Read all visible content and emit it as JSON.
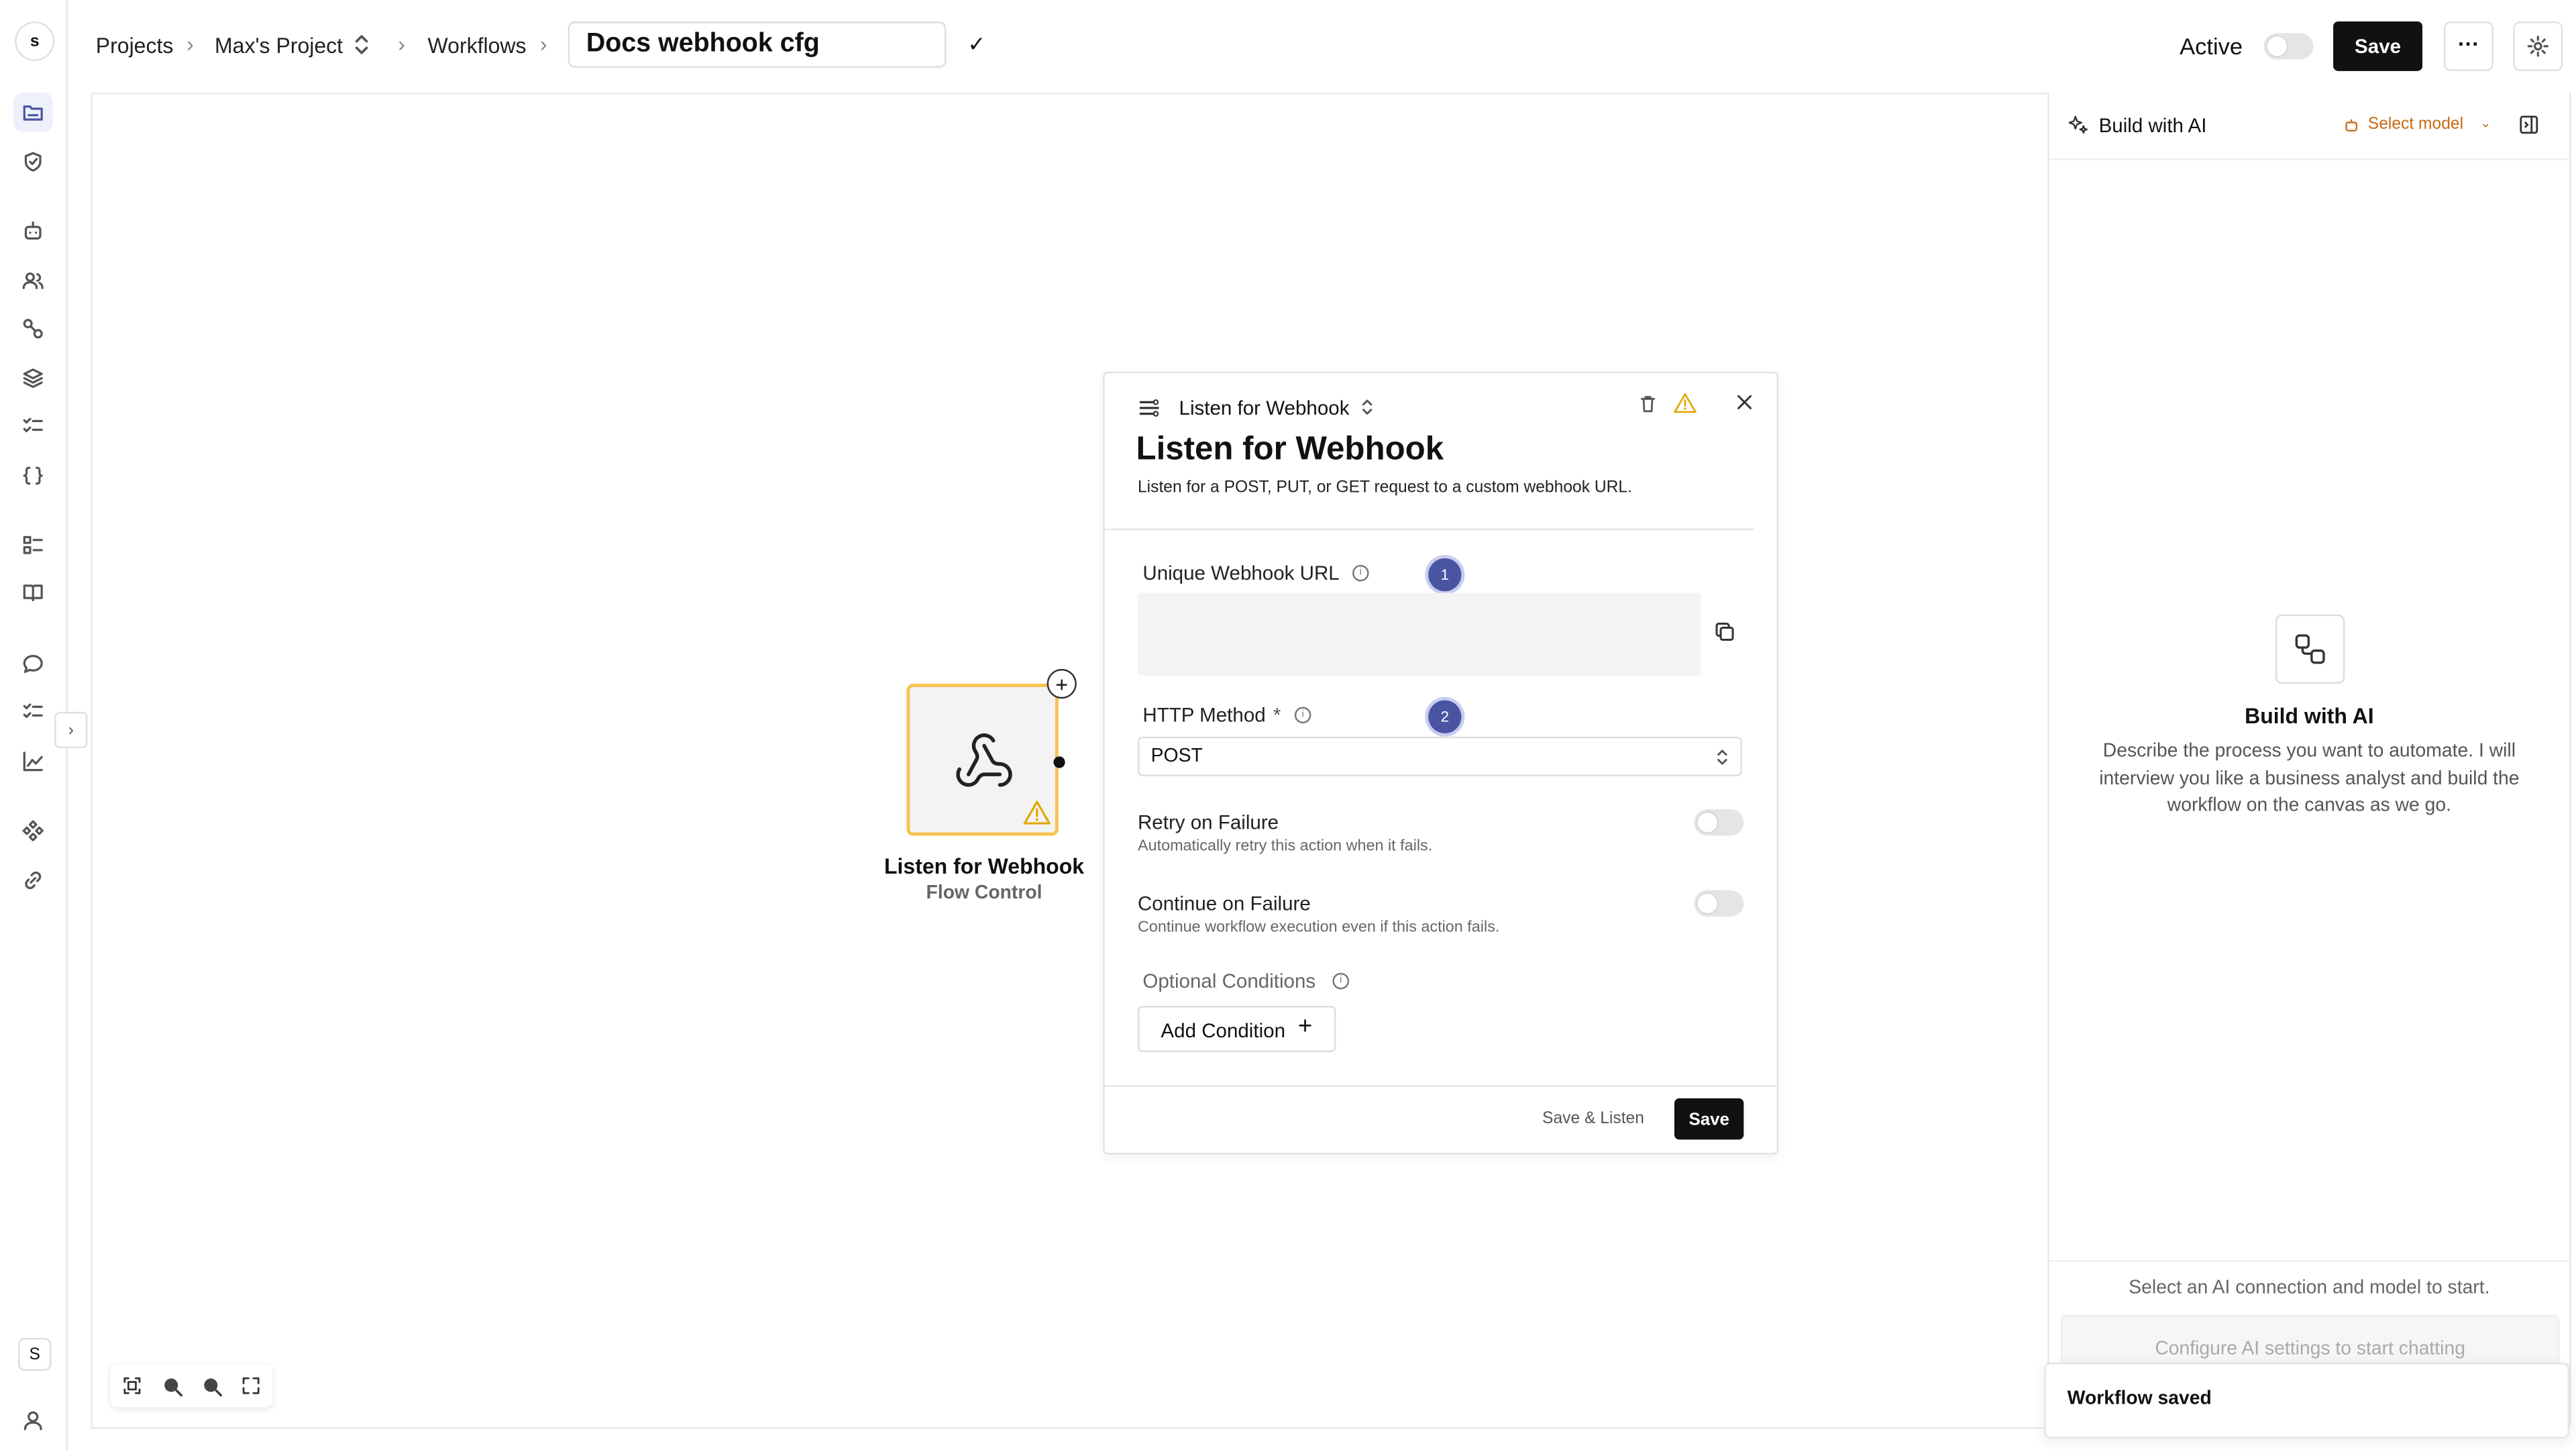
{
  "rail": {
    "avatar_top": "s",
    "avatar_bottom": "S"
  },
  "breadcrumb": {
    "projects": "Projects",
    "project": "Max's Project",
    "workflows": "Workflows",
    "workflow_name": "Docs webhook cfg",
    "check": "✓"
  },
  "topbar": {
    "active_label": "Active",
    "active": false,
    "save_label": "Save",
    "more_label": "···"
  },
  "node": {
    "title": "Listen for Webhook",
    "subtitle": "Flow Control",
    "warning": true
  },
  "panel": {
    "type_label": "Listen for Webhook",
    "title": "Listen for Webhook",
    "description": "Listen for a POST, PUT, or GET request to a custom webhook URL.",
    "url_label": "Unique Webhook URL",
    "url_value": "",
    "badge1": "1",
    "method_label": "HTTP Method",
    "required_mark": "*",
    "badge2": "2",
    "method_value": "POST",
    "retry_label": "Retry on Failure",
    "retry_desc": "Automatically retry this action when it fails.",
    "retry_on": false,
    "continue_label": "Continue on Failure",
    "continue_desc": "Continue workflow execution even if this action fails.",
    "continue_on": false,
    "conditions_label": "Optional Conditions",
    "add_condition_label": "Add Condition",
    "save_listen_label": "Save & Listen",
    "save_label": "Save"
  },
  "ai": {
    "header_title": "Build with AI",
    "select_model_label": "Select model",
    "accent": "#c96a12",
    "empty_title": "Build with AI",
    "empty_desc": "Describe the process you want to automate. I will interview you like a business analyst and build the workflow on the canvas as we go.",
    "hint": "Select an AI connection and model to start.",
    "input_placeholder": "Configure AI settings to start chatting"
  },
  "toast": {
    "message": "Workflow saved"
  }
}
